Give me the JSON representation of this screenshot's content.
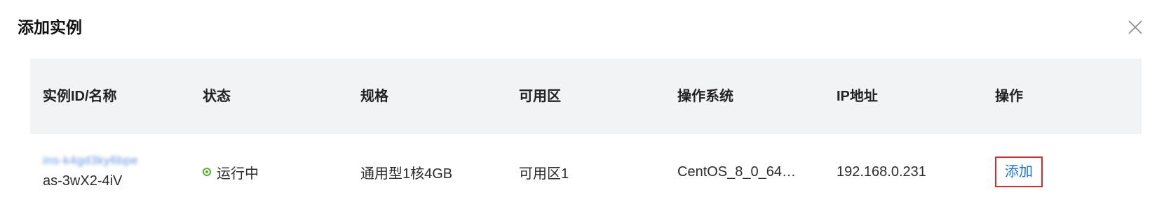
{
  "dialog": {
    "title": "添加实例"
  },
  "table": {
    "columns": [
      "实例ID/名称",
      "状态",
      "规格",
      "可用区",
      "操作系统",
      "IP地址",
      "操作"
    ],
    "rows": [
      {
        "instance_id": "ins-k4gd3ky6bpe",
        "instance_name": "as-3wX2-4iV",
        "status": "运行中",
        "spec": "通用型1核4GB",
        "zone": "可用区1",
        "os": "CentOS_8_0_64…",
        "ip": "192.168.0.231",
        "action": "添加"
      }
    ]
  },
  "colors": {
    "header_bg": "#f2f3f5",
    "link": "#1a73e8",
    "status_running": "#52b52a",
    "highlight_border": "#e0292b"
  }
}
